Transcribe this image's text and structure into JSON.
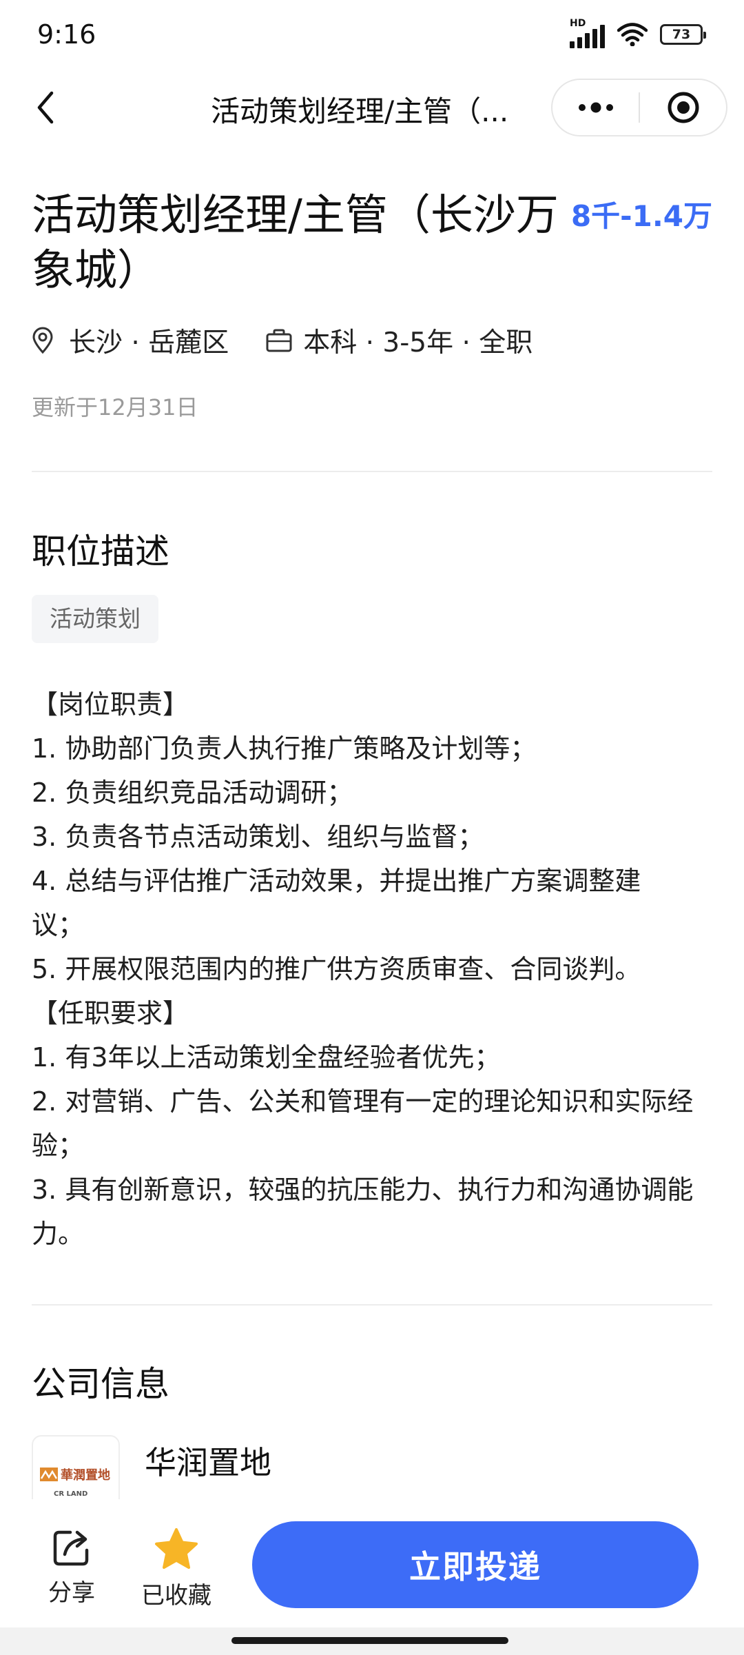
{
  "status_bar": {
    "time": "9:16",
    "network_label": "HD",
    "battery": "73"
  },
  "nav": {
    "title": "活动策划经理/主管（...",
    "icons": {
      "back": "chevron-left-icon",
      "more": "more-dots-icon",
      "close": "target-icon"
    }
  },
  "job": {
    "title": "活动策划经理/主管（长沙万象城）",
    "salary": "8千-1.4万",
    "location": "长沙 · 岳麓区",
    "requirements": "本科 · 3-5年 · 全职",
    "updated": "更新于12月31日"
  },
  "description": {
    "section_title": "职位描述",
    "tag": "活动策划",
    "lines": [
      "【岗位职责】",
      "1. 协助部门负责人执行推广策略及计划等；",
      "2. 负责组织竞品活动调研；",
      "3. 负责各节点活动策划、组织与监督；",
      "4. 总结与评估推广活动效果，并提出推广方案调整建议；",
      "5. 开展权限范围内的推广供方资质审查、合同谈判。",
      "【任职要求】",
      "1. 有3年以上活动策划全盘经验者优先；",
      "2. 对营销、广告、公关和管理有一定的理论知识和实际经验；",
      "3. 具有创新意识，较强的抗压能力、执行力和沟通协调能力。"
    ]
  },
  "company": {
    "section_title": "公司信息",
    "name": "华润置地",
    "logo_text": "華潤置地",
    "logo_sub": "CR LAND"
  },
  "bottom_bar": {
    "share_label": "分享",
    "favorite_label": "已收藏",
    "apply_label": "立即投递",
    "colors": {
      "accent": "#3d6cf7",
      "star": "#f7b526",
      "salary": "#3b6cf5"
    }
  }
}
